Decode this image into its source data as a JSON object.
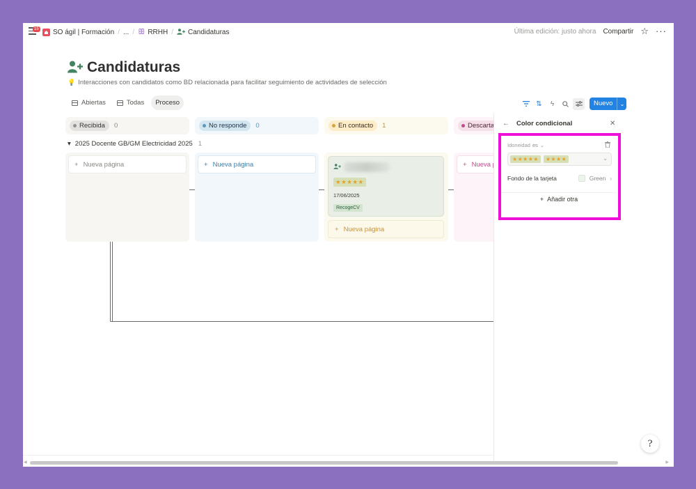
{
  "topbar": {
    "menu_badge": "15",
    "breadcrumbs": [
      "SO ágil | Formación",
      "...",
      "RRHH",
      "Candidaturas"
    ],
    "last_edit": "Última edición: justo ahora",
    "share_label": "Compartir",
    "icons": {
      "menu": "menu-icon",
      "home": "home-icon",
      "people": "people-icon",
      "person_add": "person-add-icon",
      "star": "star-icon",
      "more": "more-icon"
    }
  },
  "page": {
    "title": "Candidaturas",
    "description": "Interacciones con candidatos como BD relacionada para facilitar seguimiento de actividades de selección",
    "icon": "person-add-icon",
    "accent_color": "#448361"
  },
  "views": {
    "tabs": [
      {
        "label": "Abiertas",
        "icon": "table-icon",
        "active": false
      },
      {
        "label": "Todas",
        "icon": "table-icon",
        "active": false
      },
      {
        "label": "Proceso",
        "icon": "board-icon",
        "active": true
      }
    ]
  },
  "toolbar": {
    "new_label": "Nuevo",
    "icons": [
      "filter-icon",
      "sort-icon",
      "automation-icon",
      "search-icon",
      "settings-icon"
    ],
    "button_color": "#2383e2"
  },
  "board": {
    "columns": [
      {
        "status": "Recibida",
        "count": "0",
        "pill_bg": "#e3e2e0",
        "dot": "#91918e",
        "col_bg": "#f7f6f3"
      },
      {
        "status": "No responde",
        "count": "0",
        "pill_bg": "#d3e5ef",
        "dot": "#5b97bd",
        "col_bg": "#f2f7fb"
      },
      {
        "status": "En contacto",
        "count": "1",
        "pill_bg": "#fdecc8",
        "dot": "#d9a23c",
        "col_bg": "#fcf9ee"
      },
      {
        "status": "Descartado",
        "count": "",
        "pill_bg": "#f5e0e9",
        "dot": "#c14c8a",
        "col_bg": "#fcf4f8"
      }
    ],
    "group": {
      "title": "2025 Docente GB/GM Electricidad 2025",
      "count": "1"
    },
    "new_page_label": "Nueva página",
    "card": {
      "rating": "★★★★★",
      "date": "17/06/2025",
      "tag": "RecogeCV"
    }
  },
  "panel": {
    "title": "Color condicional",
    "condition": {
      "property": "Idoneidad",
      "operator": "es",
      "values": [
        "★★★★★",
        "★★★★"
      ]
    },
    "background": {
      "label": "Fondo de la tarjeta",
      "color_name": "Green",
      "swatch": "#eef3ec"
    },
    "add_label": "Añadir otra",
    "highlight_color": "#ee10d6"
  },
  "help": {
    "glyph": "?"
  }
}
